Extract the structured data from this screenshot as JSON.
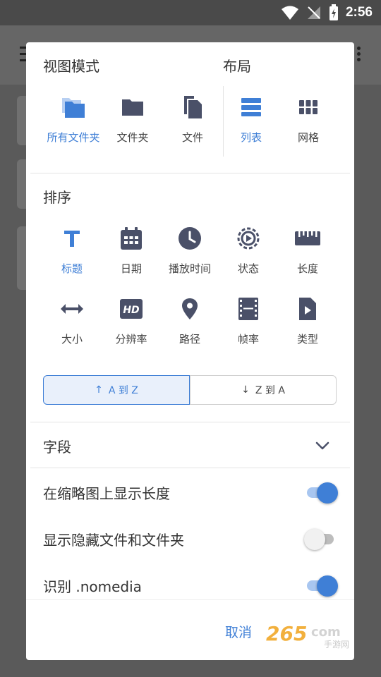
{
  "status_bar": {
    "time": "2:56"
  },
  "dialog": {
    "view_mode_title": "视图模式",
    "layout_title": "布局",
    "view_modes": [
      {
        "label": "所有文件夹",
        "icon": "folders-icon",
        "active": true
      },
      {
        "label": "文件夹",
        "icon": "folder-icon",
        "active": false
      },
      {
        "label": "文件",
        "icon": "file-icon",
        "active": false
      }
    ],
    "layouts": [
      {
        "label": "列表",
        "icon": "list-icon",
        "active": true
      },
      {
        "label": "网格",
        "icon": "grid-icon",
        "active": false
      }
    ],
    "sort_title": "排序",
    "sort_options": [
      {
        "label": "标题",
        "icon": "title-icon",
        "active": true
      },
      {
        "label": "日期",
        "icon": "calendar-icon",
        "active": false
      },
      {
        "label": "播放时间",
        "icon": "clock-icon",
        "active": false
      },
      {
        "label": "状态",
        "icon": "status-icon",
        "active": false
      },
      {
        "label": "长度",
        "icon": "ruler-icon",
        "active": false
      },
      {
        "label": "大小",
        "icon": "size-icon",
        "active": false
      },
      {
        "label": "分辨率",
        "icon": "hd-icon",
        "active": false
      },
      {
        "label": "路径",
        "icon": "location-icon",
        "active": false
      },
      {
        "label": "帧率",
        "icon": "film-icon",
        "active": false
      },
      {
        "label": "类型",
        "icon": "video-file-icon",
        "active": false
      }
    ],
    "order": {
      "asc": "A 到 Z",
      "desc": "Z 到 A",
      "selected": "asc"
    },
    "fields_label": "字段",
    "toggles": [
      {
        "label": "在缩略图上显示长度",
        "on": true
      },
      {
        "label": "显示隐藏文件和文件夹",
        "on": false
      },
      {
        "label": "识别 .nomedia",
        "on": true
      }
    ],
    "cancel_label": "取消"
  },
  "colors": {
    "accent": "#3f7fd6",
    "icon": "#4a5068"
  }
}
